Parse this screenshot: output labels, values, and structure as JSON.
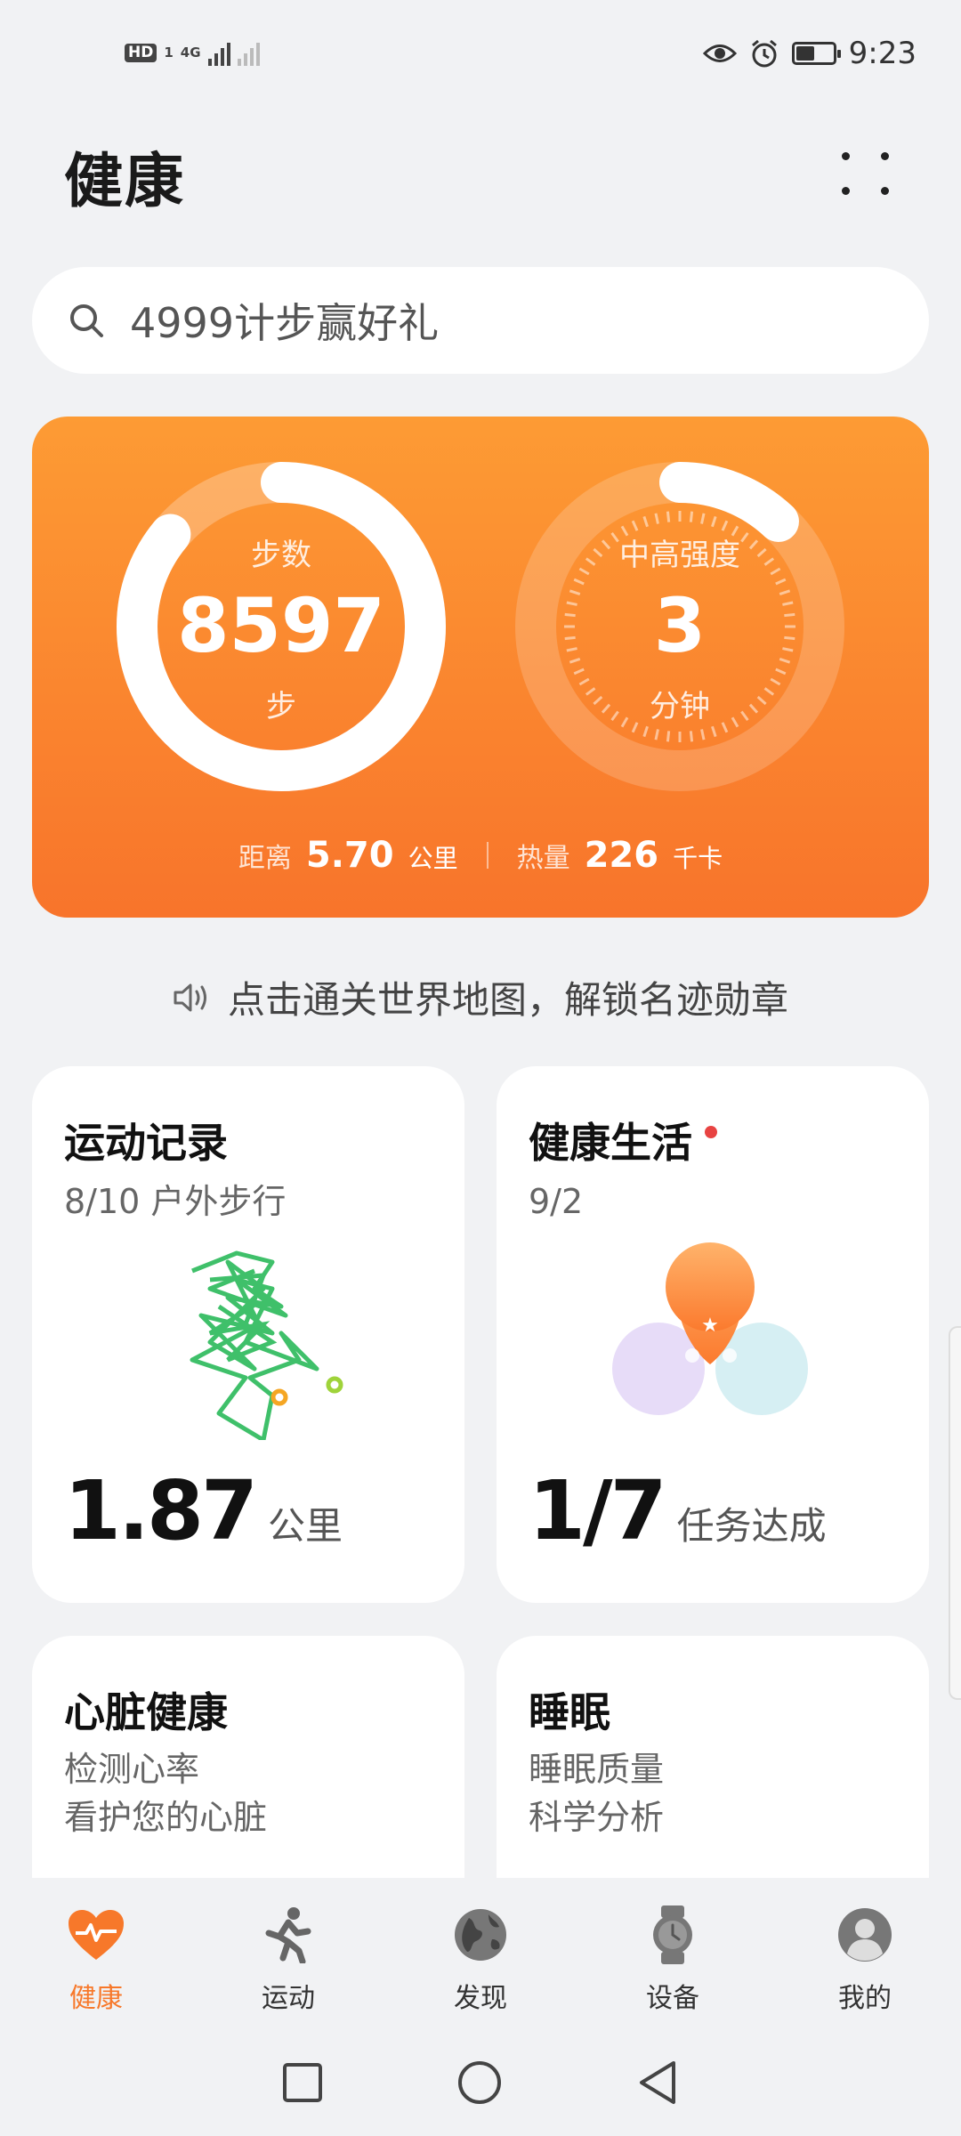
{
  "status_bar": {
    "hd_badge": "HD",
    "sim": "1",
    "network": "4G",
    "time": "9:23"
  },
  "header": {
    "title": "健康"
  },
  "search": {
    "text": "4999计步赢好礼"
  },
  "activity": {
    "steps_label": "步数",
    "steps_value": "8597",
    "steps_unit": "步",
    "steps_progress": 0.86,
    "intensity_label": "中高强度",
    "intensity_value": "3",
    "intensity_unit": "分钟",
    "intensity_progress": 0.12,
    "distance_label": "距离",
    "distance_value": "5.70",
    "distance_unit": "公里",
    "calories_label": "热量",
    "calories_value": "226",
    "calories_unit": "千卡",
    "accent_color": "#f8742b"
  },
  "notice": {
    "text": "点击通关世界地图，解锁名迹勋章"
  },
  "cards": {
    "exercise": {
      "title": "运动记录",
      "subtitle": "8/10 户外步行",
      "value": "1.87",
      "unit": "公里"
    },
    "healthy_living": {
      "title": "健康生活",
      "subtitle": "9/2",
      "value": "1/7",
      "unit": "任务达成"
    },
    "heart": {
      "title": "心脏健康",
      "line1": "检测心率",
      "line2": "看护您的心脏"
    },
    "sleep": {
      "title": "睡眠",
      "line1": "睡眠质量",
      "line2": "科学分析"
    }
  },
  "bottom_nav": [
    {
      "label": "健康",
      "icon": "heart-pulse-icon",
      "active": true
    },
    {
      "label": "运动",
      "icon": "runner-icon",
      "active": false
    },
    {
      "label": "发现",
      "icon": "globe-icon",
      "active": false
    },
    {
      "label": "设备",
      "icon": "watch-icon",
      "active": false
    },
    {
      "label": "我的",
      "icon": "profile-icon",
      "active": false
    }
  ]
}
